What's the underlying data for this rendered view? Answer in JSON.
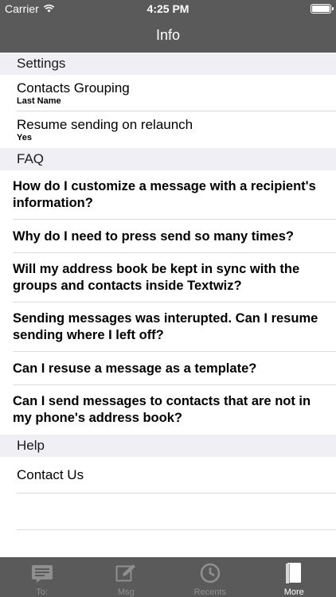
{
  "status_bar": {
    "carrier": "Carrier",
    "time": "4:25 PM"
  },
  "nav": {
    "title": "Info"
  },
  "settings": {
    "header": "Settings",
    "items": [
      {
        "title": "Contacts Grouping",
        "value": "Last Name"
      },
      {
        "title": "Resume sending on relaunch",
        "value": "Yes"
      }
    ]
  },
  "faq": {
    "header": "FAQ",
    "items": [
      "How do I customize a message with a recipient's information?",
      "Why do I need to press send so many times?",
      "Will my address book be kept in sync with the groups and contacts inside Textwiz?",
      "Sending messages was interupted. Can I resume sending where I left off?",
      "Can I resuse a message as a template?",
      "Can I send messages to contacts that are not in my phone's address book?"
    ]
  },
  "help": {
    "header": "Help",
    "items": [
      "Contact Us",
      ""
    ]
  },
  "tabbar": {
    "tabs": [
      {
        "label": "To:",
        "icon": "compose-list-icon",
        "active": false
      },
      {
        "label": "Msg",
        "icon": "pencil-square-icon",
        "active": false
      },
      {
        "label": "Recents",
        "icon": "clock-icon",
        "active": false
      },
      {
        "label": "More",
        "icon": "book-icon",
        "active": true
      }
    ]
  },
  "colors": {
    "bar": "#5a5a5a",
    "section_bg": "#efeff4",
    "tab_inactive": "#8f8f8f",
    "tab_active": "#ffffff"
  }
}
